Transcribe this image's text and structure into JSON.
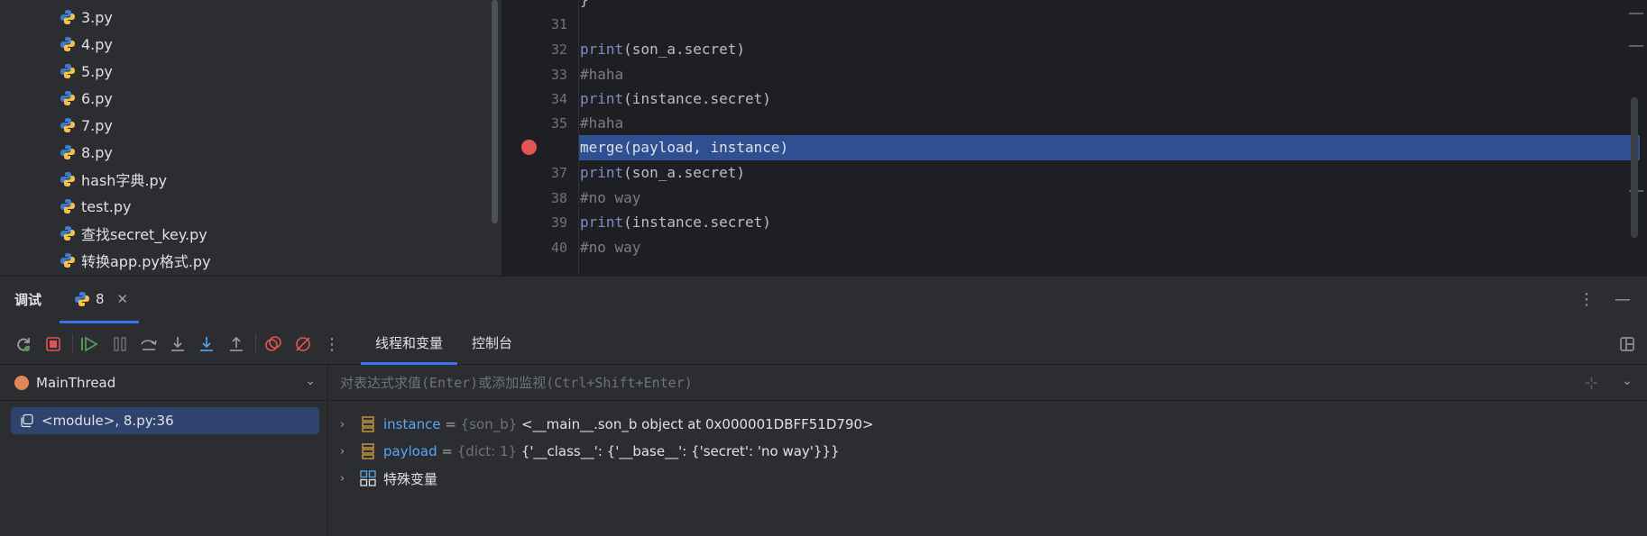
{
  "project": {
    "files": [
      "3.py",
      "4.py",
      "5.py",
      "6.py",
      "7.py",
      "8.py",
      "hash字典.py",
      "test.py",
      "查找secret_key.py",
      "转换app.py格式.py"
    ]
  },
  "editor": {
    "partial_top_line": "}",
    "lines": [
      {
        "num": "31",
        "code": ""
      },
      {
        "num": "32",
        "fn": "print",
        "rest": "(son_a.secret)"
      },
      {
        "num": "33",
        "comment": "#haha"
      },
      {
        "num": "34",
        "fn": "print",
        "rest": "(instance.secret)"
      },
      {
        "num": "35",
        "comment": "#haha"
      },
      {
        "num": "",
        "code": "merge(payload, instance)",
        "highlighted": true,
        "breakpoint": true
      },
      {
        "num": "37",
        "fn": "print",
        "rest": "(son_a.secret)"
      },
      {
        "num": "38",
        "comment": "#no way"
      },
      {
        "num": "39",
        "fn": "print",
        "rest": "(instance.secret)"
      },
      {
        "num": "40",
        "comment": "#no way"
      }
    ]
  },
  "debug": {
    "title": "调试",
    "session_tab": "8",
    "tabs": [
      "线程和变量",
      "控制台"
    ],
    "thread": "MainThread",
    "frame": "<module>, 8.py:36",
    "expression_placeholder": "对表达式求值(Enter)或添加监视(Ctrl+Shift+Enter)",
    "variables": [
      {
        "name": "instance",
        "eq": " = ",
        "type": "{son_b} ",
        "value": "<__main__.son_b object at 0x000001DBFF51D790>"
      },
      {
        "name": "payload",
        "eq": " = ",
        "type": "{dict: 1} ",
        "value": "{'__class__': {'__base__': {'secret': 'no way'}}}"
      }
    ],
    "special_vars": "特殊变量"
  },
  "colors": {
    "accent": "#3574f0",
    "highlight_line": "#2e4f91",
    "breakpoint": "#e55353"
  }
}
